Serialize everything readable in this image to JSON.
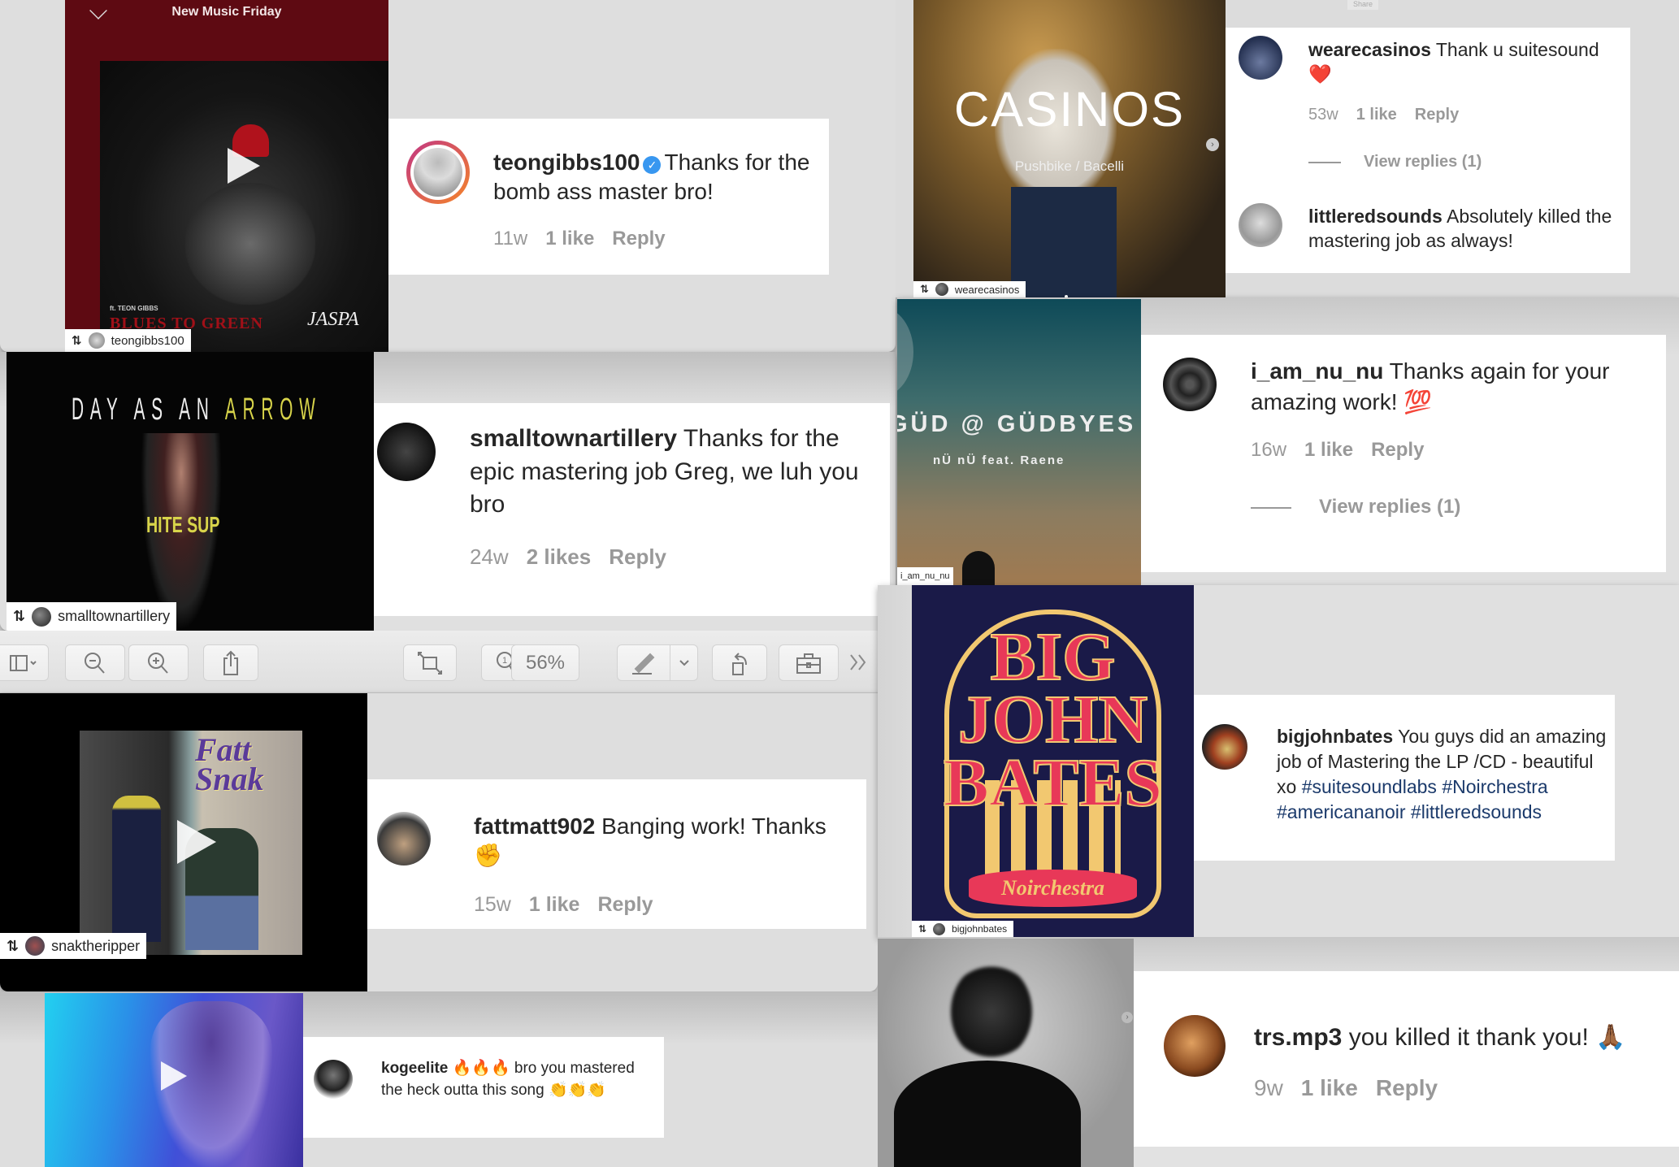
{
  "share_label": "Share",
  "posts": [
    {
      "art_title": "New Music Friday",
      "art_subtitle": "ft. TEON GIBBS",
      "art_text": "BLUES TO GREEN",
      "art_signature": "JASPA",
      "repost_user": "teongibbs100",
      "comment": {
        "user": "teongibbs100",
        "verified": true,
        "text": "Thanks for the bomb ass master bro!",
        "time": "11w",
        "likes": "1 like",
        "reply": "Reply"
      }
    },
    {
      "art_title": "CASINOS",
      "art_subtitle": "Pushbike / Bacelli",
      "repost_user": "wearecasinos",
      "comments": [
        {
          "user": "wearecasinos",
          "text": "Thank u suitesound ❤️",
          "time": "53w",
          "likes": "1 like",
          "reply": "Reply",
          "view_replies": "View replies (1)"
        },
        {
          "user": "littleredsounds",
          "text": "Absolutely killed the mastering job as always!"
        }
      ]
    },
    {
      "art_title_white": "DAY AS AN",
      "art_title_yellow": "ARROW",
      "art_text": "HITE SUP",
      "repost_user": "smalltownartillery",
      "comment": {
        "user": "smalltownartillery",
        "text": "Thanks for the epic mastering job Greg, we luh you bro",
        "time": "24w",
        "likes": "2 likes",
        "reply": "Reply"
      }
    },
    {
      "art_title": "GÜD @ GÜDBYES",
      "art_subtitle": "nÜ nÜ feat. Raene",
      "repost_user": "i_am_nu_nu",
      "comment": {
        "user": "i_am_nu_nu",
        "text": "Thanks again for your amazing work! 💯",
        "time": "16w",
        "likes": "1 like",
        "reply": "Reply",
        "view_replies": "View replies (1)"
      }
    },
    {
      "art_title": "Fatt Snak",
      "repost_user": "snaktheripper",
      "comment": {
        "user": "fattmatt902",
        "text": "Banging work! Thanks ✊",
        "time": "15w",
        "likes": "1 like",
        "reply": "Reply"
      }
    },
    {
      "art_title_lines": [
        "BIG",
        "JOHN",
        "BATES"
      ],
      "art_banner": "Noirchestra",
      "repost_user": "bigjohnbates",
      "comment": {
        "user": "bigjohnbates",
        "text": "You guys did an amazing job of Mastering the LP /CD - beautiful xo",
        "hashtags": [
          "#suitesoundlabs",
          "#Noirchestra",
          "#americananoir",
          "#littleredsounds"
        ]
      }
    },
    {
      "comment": {
        "user": "kogeelite",
        "text": "🔥🔥🔥 bro you mastered the heck outta this song 👏👏👏"
      }
    },
    {
      "comment": {
        "user": "trs.mp3",
        "text": "you killed it thank you! 🙏🏾",
        "time": "9w",
        "likes": "1 like",
        "reply": "Reply"
      }
    }
  ],
  "toolbar": {
    "zoom_level": "56%",
    "buttons": [
      {
        "name": "sidebar-toggle",
        "icon": "sidebar-icon"
      },
      {
        "name": "zoom-out",
        "icon": "zoom-out-icon"
      },
      {
        "name": "zoom-in",
        "icon": "zoom-in-icon"
      },
      {
        "name": "share",
        "icon": "share-icon"
      },
      {
        "name": "fit",
        "icon": "resize-icon"
      },
      {
        "name": "actual-size",
        "icon": "actual-size-icon"
      },
      {
        "name": "markup",
        "icon": "pen-icon"
      },
      {
        "name": "rotate",
        "icon": "rotate-icon"
      },
      {
        "name": "toolbox",
        "icon": "toolbox-icon"
      },
      {
        "name": "more",
        "icon": "chevron-right-double-icon"
      }
    ]
  }
}
